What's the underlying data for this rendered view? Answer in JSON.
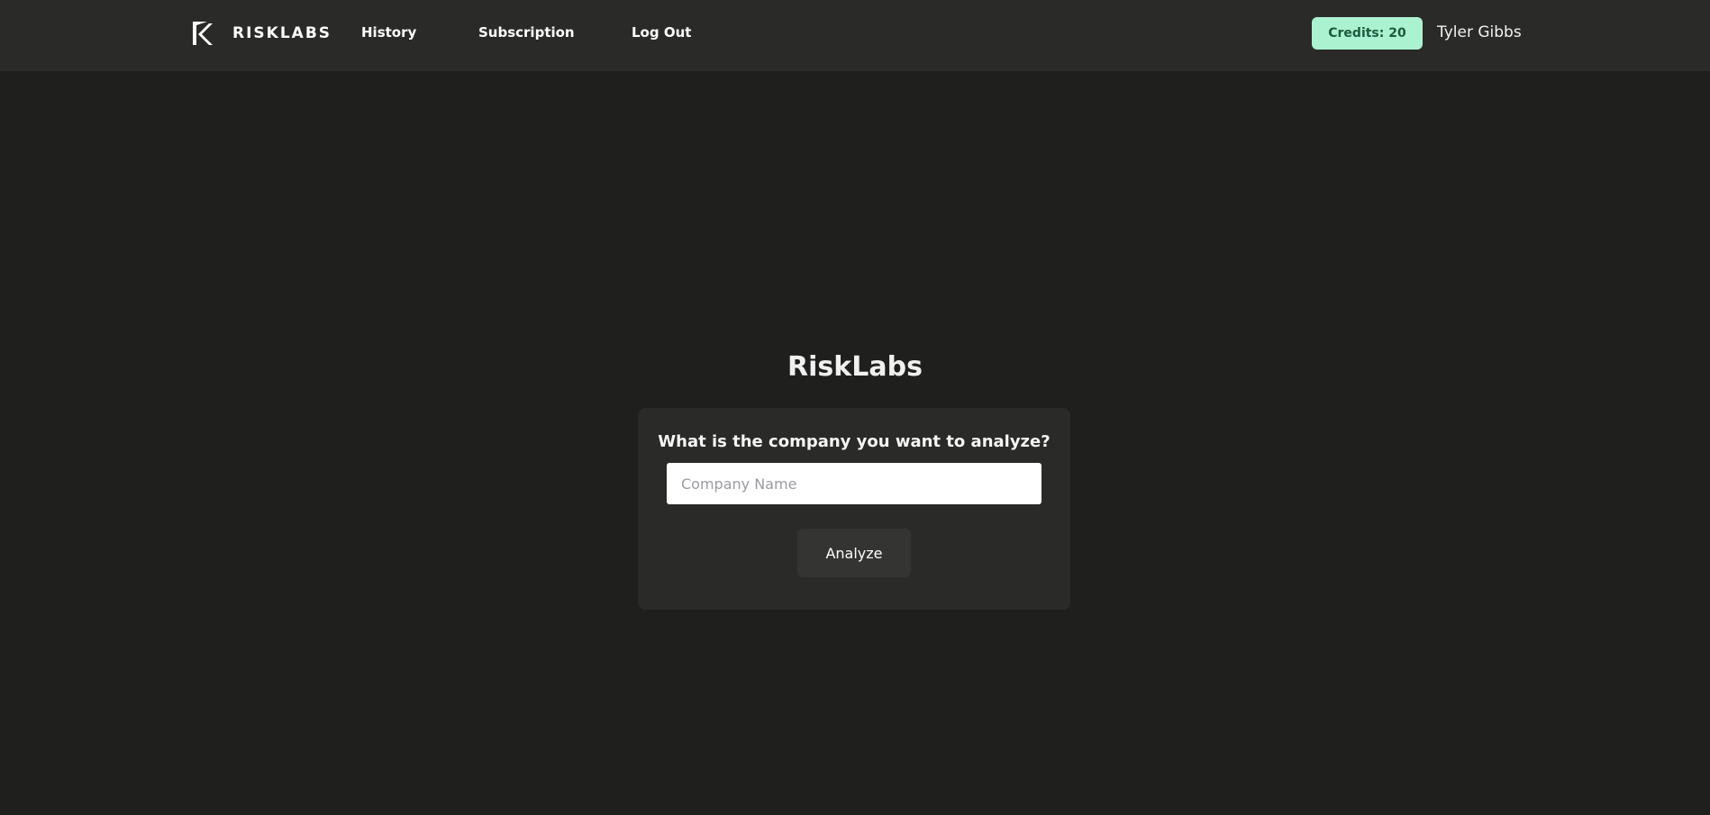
{
  "header": {
    "brand_name": "RISKLABS",
    "logo_icon": "risklabs-k-logo-icon",
    "nav": {
      "history": "History",
      "subscription": "Subscription",
      "logout": "Log Out"
    },
    "credits_label": "Credits: 20",
    "user_name": "Tyler Gibbs"
  },
  "main": {
    "title": "RiskLabs",
    "question": "What is the company you want to analyze?",
    "input": {
      "value": "",
      "placeholder": "Company Name"
    },
    "analyze_label": "Analyze"
  },
  "colors": {
    "background": "#1f1f1d",
    "header_background": "#2a2a29",
    "card_background": "#2a2a29",
    "credits_badge": "#abf2d0",
    "credits_text": "#1b5b3f",
    "button_background": "#343433"
  }
}
